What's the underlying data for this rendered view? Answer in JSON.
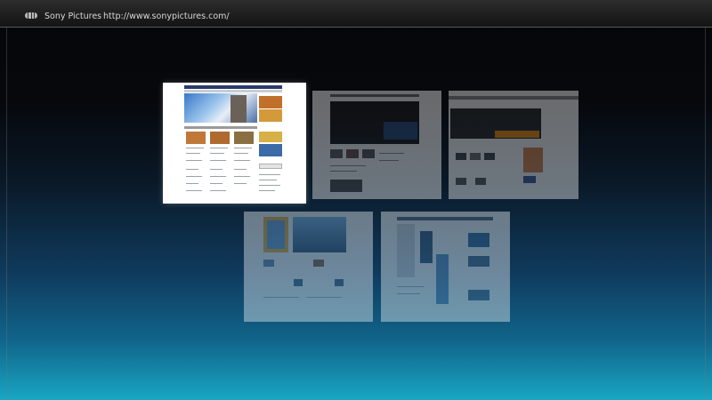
{
  "browser": {
    "page_title": "Sony Pictures",
    "url": "http://www.sonypictures.com/",
    "icon": "globe-icon"
  },
  "thumbnails": [
    {
      "label": "tab-1",
      "active": true
    },
    {
      "label": "tab-2",
      "active": false
    },
    {
      "label": "tab-3",
      "active": false
    },
    {
      "label": "tab-4",
      "active": false
    },
    {
      "label": "tab-5",
      "active": false
    }
  ],
  "colors": {
    "topbar": "#1e1e1e",
    "background_top": "#050608",
    "background_bottom": "#18a6c4",
    "active_border": "#ffffff"
  }
}
